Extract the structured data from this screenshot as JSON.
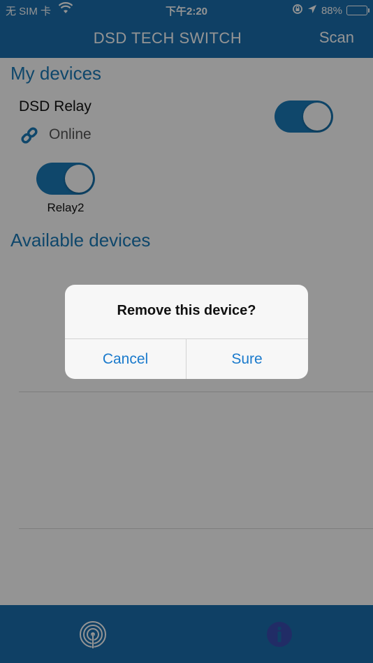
{
  "status_bar": {
    "carrier": "无 SIM 卡",
    "time": "下午2:20",
    "battery": "88%",
    "battery_level": 0.88,
    "icons": [
      "wifi-icon",
      "orientation-lock-icon",
      "location-icon",
      "battery-icon"
    ]
  },
  "nav": {
    "title": "DSD TECH SWITCH",
    "scan_label": "Scan"
  },
  "my_devices": {
    "heading": "My devices",
    "device": {
      "name": "DSD Relay",
      "status": "Online",
      "status_icon": "link-icon",
      "power_on": true
    },
    "relays": [
      {
        "label": "Relay2",
        "on": true
      }
    ]
  },
  "available_devices": {
    "heading": "Available devices"
  },
  "tabbar": {
    "items": [
      {
        "icon": "broadcast-icon"
      },
      {
        "icon": "info-icon"
      }
    ]
  },
  "dialog": {
    "message": "Remove this device?",
    "cancel_label": "Cancel",
    "sure_label": "Sure"
  },
  "colors": {
    "bar_blue": "#1a6fae",
    "accent_blue": "#1a7ab8",
    "dialog_button": "#1a7acc"
  }
}
